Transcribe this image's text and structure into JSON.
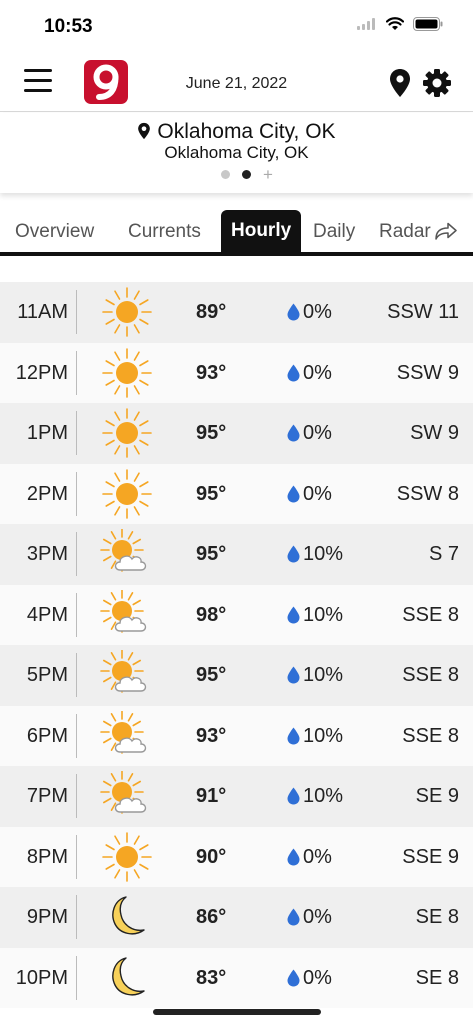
{
  "status": {
    "time": "10:53"
  },
  "header": {
    "date": "June 21, 2022"
  },
  "location": {
    "name": "Oklahoma City, OK",
    "subtitle": "Oklahoma City, OK"
  },
  "tabs": [
    {
      "label": "Overview",
      "active": false
    },
    {
      "label": "Currents",
      "active": false
    },
    {
      "label": "Hourly",
      "active": true
    },
    {
      "label": "Daily",
      "active": false
    },
    {
      "label": "Radar",
      "active": false
    }
  ],
  "colors": {
    "sun": "#f5a623",
    "drop": "#2f6fd6",
    "moon": "#f7d15a",
    "logo": "#c8102e"
  },
  "hourly": [
    {
      "time": "11AM",
      "icon": "sunny",
      "temp": "89°",
      "precip": "0%",
      "wind": "SSW 11"
    },
    {
      "time": "12PM",
      "icon": "sunny",
      "temp": "93°",
      "precip": "0%",
      "wind": "SSW 9"
    },
    {
      "time": "1PM",
      "icon": "sunny",
      "temp": "95°",
      "precip": "0%",
      "wind": "SW 9"
    },
    {
      "time": "2PM",
      "icon": "sunny",
      "temp": "95°",
      "precip": "0%",
      "wind": "SSW 8"
    },
    {
      "time": "3PM",
      "icon": "partly-cloudy",
      "temp": "95°",
      "precip": "10%",
      "wind": "S 7"
    },
    {
      "time": "4PM",
      "icon": "partly-cloudy",
      "temp": "98°",
      "precip": "10%",
      "wind": "SSE 8"
    },
    {
      "time": "5PM",
      "icon": "partly-cloudy",
      "temp": "95°",
      "precip": "10%",
      "wind": "SSE 8"
    },
    {
      "time": "6PM",
      "icon": "partly-cloudy",
      "temp": "93°",
      "precip": "10%",
      "wind": "SSE 8"
    },
    {
      "time": "7PM",
      "icon": "partly-cloudy",
      "temp": "91°",
      "precip": "10%",
      "wind": "SE 9"
    },
    {
      "time": "8PM",
      "icon": "sunny",
      "temp": "90°",
      "precip": "0%",
      "wind": "SSE 9"
    },
    {
      "time": "9PM",
      "icon": "moon",
      "temp": "86°",
      "precip": "0%",
      "wind": "SE 8"
    },
    {
      "time": "10PM",
      "icon": "moon",
      "temp": "83°",
      "precip": "0%",
      "wind": "SE 8"
    }
  ]
}
